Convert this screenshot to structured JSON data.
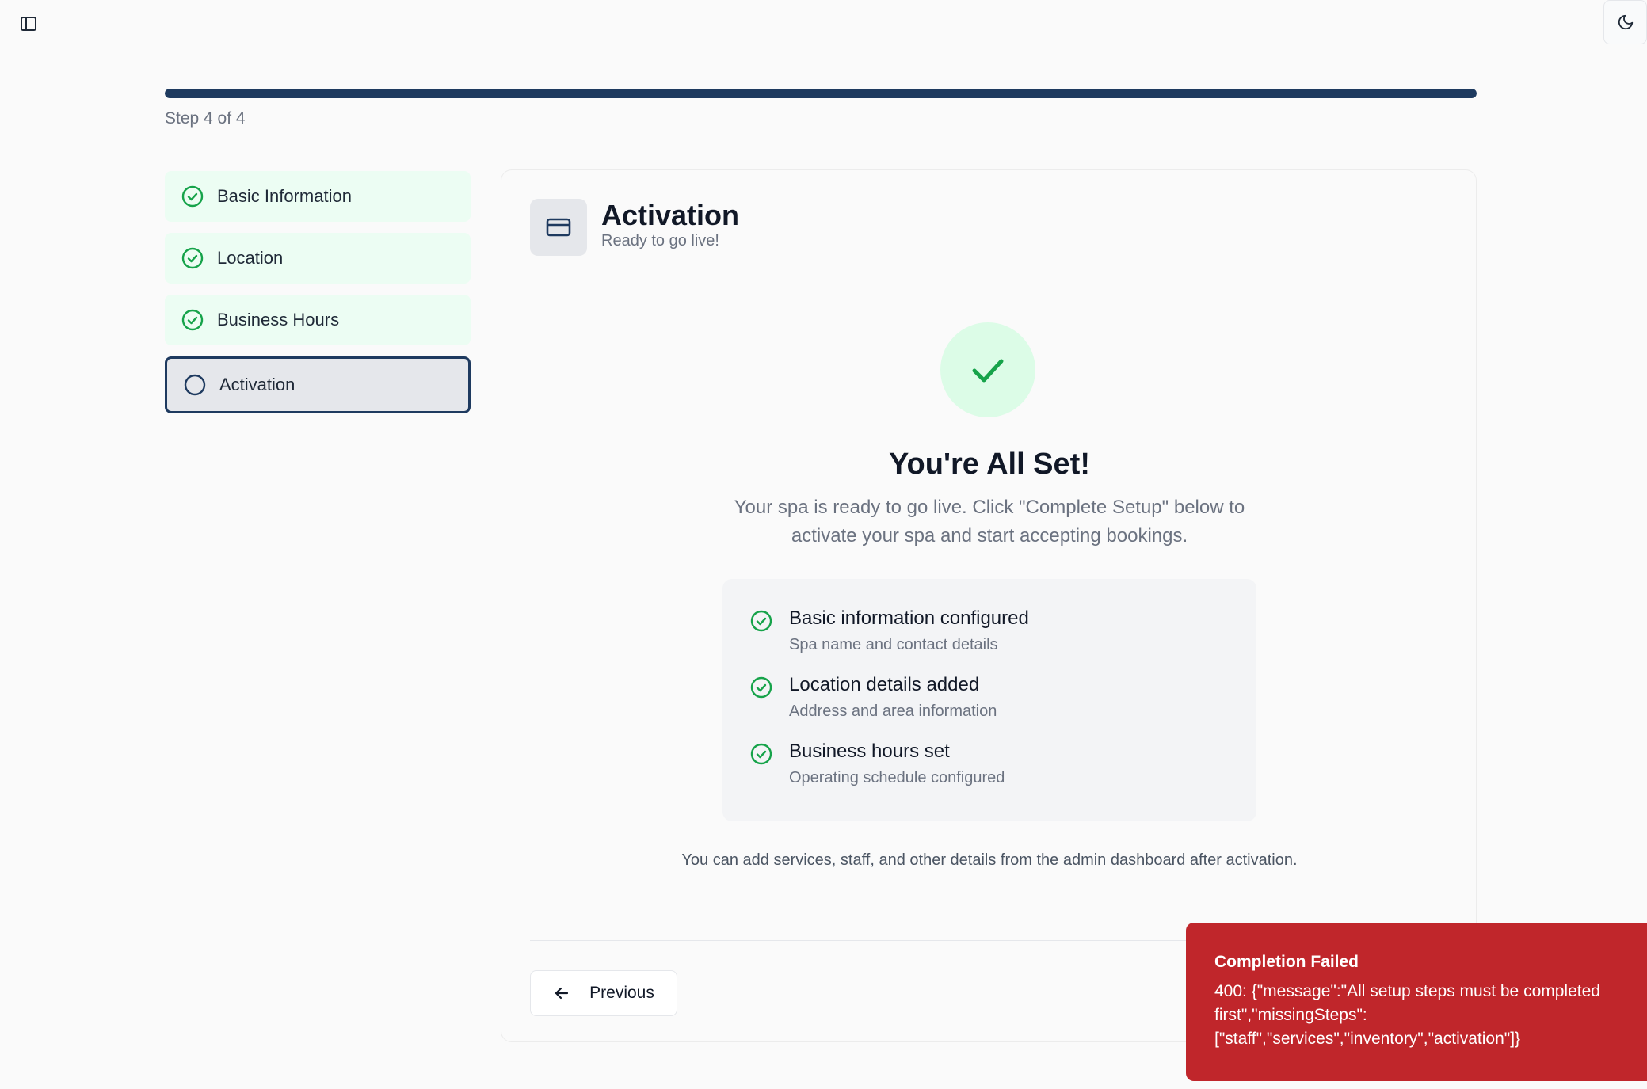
{
  "icons": {
    "sidebar": "sidebar-panel-icon",
    "theme": "moon-icon",
    "step_done": "check-circle-icon",
    "step_current": "empty-circle-icon",
    "card": "credit-card-icon",
    "success": "check-icon",
    "back": "arrow-left-icon"
  },
  "colors": {
    "accent": "#1e3a5f",
    "success": "#16a34a",
    "success_bg": "#dcfce7",
    "step_done_bg": "#ecfdf3",
    "error": "#c0262b"
  },
  "progress": {
    "fraction": 1.0,
    "label": "Step 4 of 4"
  },
  "steps": [
    {
      "label": "Basic Information",
      "status": "completed"
    },
    {
      "label": "Location",
      "status": "completed"
    },
    {
      "label": "Business Hours",
      "status": "completed"
    },
    {
      "label": "Activation",
      "status": "current"
    }
  ],
  "card": {
    "title": "Activation",
    "subtitle": "Ready to go live!",
    "heading": "You're All Set!",
    "description": "Your spa is ready to go live. Click \"Complete Setup\" below to activate your spa and start accepting bookings.",
    "summary": [
      {
        "title": "Basic information configured",
        "desc": "Spa name and contact details"
      },
      {
        "title": "Location details added",
        "desc": "Address and area information"
      },
      {
        "title": "Business hours set",
        "desc": "Operating schedule configured"
      }
    ],
    "note": "You can add services, staff, and other details from the admin dashboard after activation.",
    "previous_label": "Previous"
  },
  "toast": {
    "title": "Completion Failed",
    "body": "400: {\"message\":\"All setup steps must be completed first\",\"missingSteps\": [\"staff\",\"services\",\"inventory\",\"activation\"]}"
  }
}
